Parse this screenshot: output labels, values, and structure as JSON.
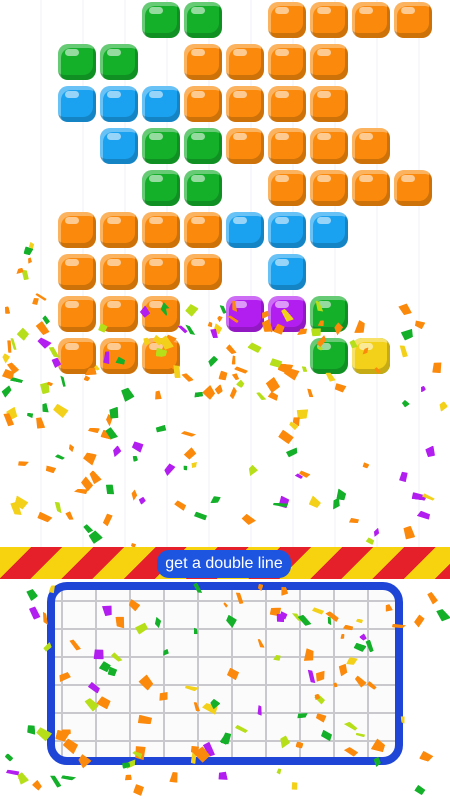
{
  "colors": {
    "orange": "#fb8a0c",
    "green": "#14b02a",
    "blue": "#1aa1f0",
    "purple": "#b31ef0",
    "yellow": "#f3d11a",
    "lime": "#b6df1a",
    "hazard_red": "#e5202a",
    "hazard_yellow": "#f7d20f",
    "frame_blue": "#1f45d6"
  },
  "board": {
    "rows": [
      [
        null,
        "green",
        "green",
        null,
        "orange",
        "orange",
        "orange",
        "orange",
        null
      ],
      [
        "green",
        "green",
        null,
        "orange",
        "orange",
        "orange",
        "orange",
        null,
        null
      ],
      [
        "blue",
        "blue",
        "blue",
        "orange",
        "orange",
        "orange",
        "orange",
        null,
        null
      ],
      [
        null,
        "blue",
        "green",
        "green",
        "orange",
        "orange",
        "orange",
        "orange",
        null
      ],
      [
        null,
        "green",
        "green",
        null,
        "orange",
        "orange",
        "orange",
        "orange",
        null
      ],
      [
        "orange",
        "orange",
        "orange",
        "orange",
        "blue",
        "blue",
        "blue",
        null,
        null
      ],
      [
        "orange",
        "orange",
        "orange",
        "orange",
        null,
        "blue",
        null,
        null,
        null
      ],
      [
        "orange",
        "orange",
        "orange",
        null,
        "purple",
        "purple",
        "green",
        null,
        null
      ],
      [
        "orange",
        "orange",
        "orange",
        null,
        null,
        null,
        "green",
        "green",
        "yellow"
      ]
    ]
  },
  "hint": {
    "text": "get a double line"
  }
}
